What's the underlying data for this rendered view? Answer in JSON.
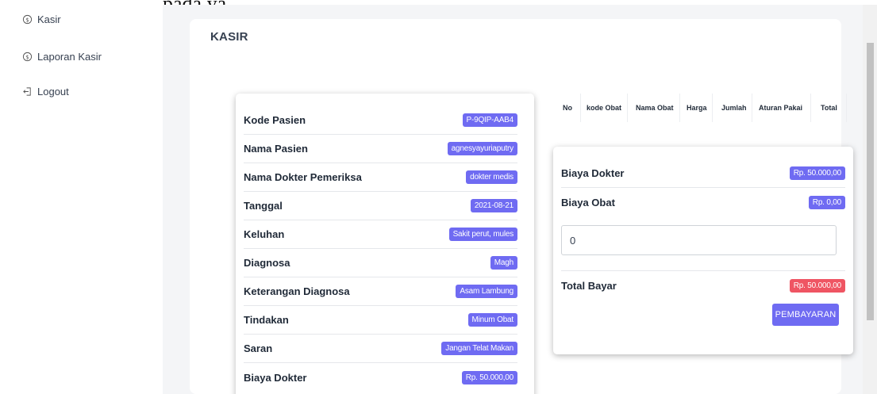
{
  "header_fragment": "pada ya",
  "sidebar": {
    "items": [
      {
        "label": "Kasir",
        "icon": "coin-icon"
      },
      {
        "label": "Laporan Kasir",
        "icon": "coin-icon"
      },
      {
        "label": "Logout",
        "icon": "logout-icon"
      }
    ]
  },
  "page": {
    "title": "KASIR"
  },
  "patient_info": [
    {
      "label": "Kode Pasien",
      "value": "P-9QIP-AAB4"
    },
    {
      "label": "Nama Pasien",
      "value": "agnesyayuriaputry"
    },
    {
      "label": "Nama Dokter Pemeriksa",
      "value": "dokter medis"
    },
    {
      "label": "Tanggal",
      "value": "2021-08-21"
    },
    {
      "label": "Keluhan",
      "value": "Sakit perut, mules"
    },
    {
      "label": "Diagnosa",
      "value": "Magh"
    },
    {
      "label": "Keterangan Diagnosa",
      "value": "Asam Lambung"
    },
    {
      "label": "Tindakan",
      "value": "Minum Obat"
    },
    {
      "label": "Saran",
      "value": "Jangan Telat Makan"
    },
    {
      "label": "Biaya Dokter",
      "value": "Rp. 50.000,00"
    }
  ],
  "medicine_table": {
    "columns": [
      "No",
      "kode Obat",
      "Nama Obat",
      "Harga",
      "Jumlah",
      "Aturan Pakai",
      "Total"
    ]
  },
  "payment": {
    "biaya_dokter_label": "Biaya Dokter",
    "biaya_dokter_value": "Rp. 50.000,00",
    "biaya_obat_label": "Biaya Obat",
    "biaya_obat_value": "Rp. 0,00",
    "input_value": "0",
    "total_label": "Total Bayar",
    "total_value": "Rp. 50.000,00",
    "button_label": "PEMBAYARAN"
  },
  "colors": {
    "badge": "#6f6bf2",
    "total_badge": "#ef5563"
  }
}
